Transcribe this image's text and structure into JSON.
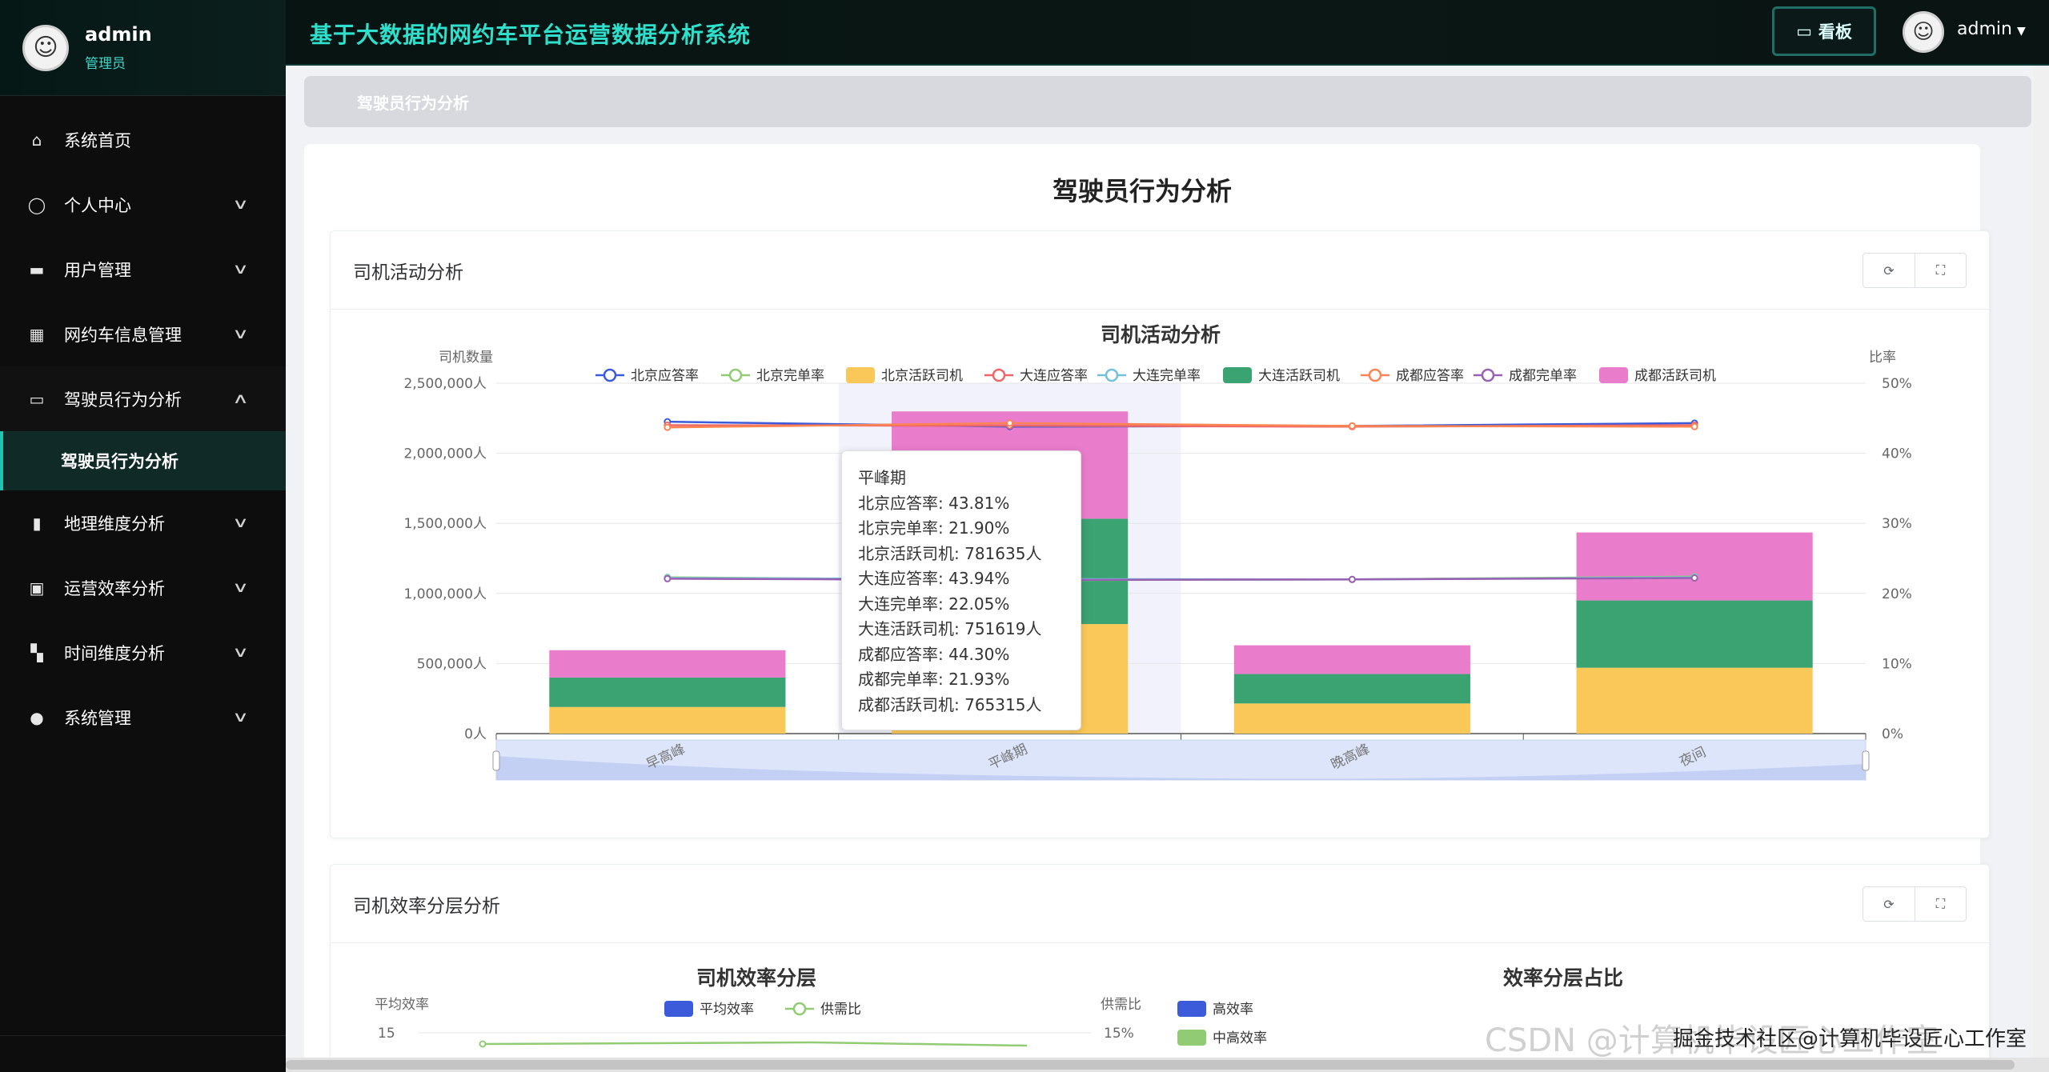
{
  "sidebar": {
    "user_name": "admin",
    "user_role": "管理员",
    "items": [
      {
        "label": "系统首页",
        "icon": "home-icon",
        "glyph": "⌂",
        "arrow": ""
      },
      {
        "label": "个人中心",
        "icon": "user-icon",
        "glyph": "◯",
        "arrow": "∨"
      },
      {
        "label": "用户管理",
        "icon": "briefcase-icon",
        "glyph": "▬",
        "arrow": "∨"
      },
      {
        "label": "网约车信息管理",
        "icon": "calendar-icon",
        "glyph": "▦",
        "arrow": "∨"
      },
      {
        "label": "驾驶员行为分析",
        "icon": "chat-icon",
        "glyph": "▭",
        "arrow": "∧"
      },
      {
        "label": "地理维度分析",
        "icon": "chart-icon",
        "glyph": "▮",
        "arrow": "∨"
      },
      {
        "label": "运营效率分析",
        "icon": "clipboard-icon",
        "glyph": "▣",
        "arrow": "∨"
      },
      {
        "label": "时间维度分析",
        "icon": "grid-icon",
        "glyph": "▚",
        "arrow": "∨"
      },
      {
        "label": "系统管理",
        "icon": "person-icon",
        "glyph": "●",
        "arrow": "∨"
      }
    ],
    "sub_item": "驾驶员行为分析"
  },
  "topbar": {
    "title": "基于大数据的网约车平台运营数据分析系统",
    "kanban_label": "看板",
    "user_name": "admin"
  },
  "breadcrumb": "驾驶员行为分析",
  "page_title": "驾驶员行为分析",
  "cards": {
    "activity_title": "司机活动分析",
    "efficiency_title": "司机效率分层分析"
  },
  "colors": {
    "beijing_rate": "#3b5bdb",
    "beijing_done": "#91cc75",
    "beijing_active": "#fac858",
    "dalian_rate": "#ee6666",
    "dalian_done": "#73c0de",
    "dalian_active": "#3ba272",
    "chengdu_rate": "#fc8452",
    "chengdu_done": "#9a60b4",
    "chengdu_active": "#ea7ccc"
  },
  "chart_data": [
    {
      "type": "bar",
      "title": "司机活动分析",
      "ylabel": "司机数量",
      "y2label": "比率",
      "categories": [
        "早高峰",
        "平峰期",
        "晚高峰",
        "夜间"
      ],
      "ylim": [
        0,
        2500000
      ],
      "y2lim": [
        0,
        50
      ],
      "y_ticks": [
        "0人",
        "500,000人",
        "1,000,000人",
        "1,500,000人",
        "2,000,000人",
        "2,500,000人"
      ],
      "y2_ticks": [
        "0%",
        "10%",
        "20%",
        "30%",
        "40%",
        "50%"
      ],
      "stacked_series": [
        {
          "name": "北京活跃司机",
          "values": [
            190000,
            781635,
            215000,
            470000
          ]
        },
        {
          "name": "大连活跃司机",
          "values": [
            210000,
            751619,
            210000,
            480000
          ]
        },
        {
          "name": "成都活跃司机",
          "values": [
            195000,
            765315,
            205000,
            485000
          ]
        }
      ],
      "line_series": [
        {
          "name": "北京应答率",
          "values": [
            44.5,
            43.81,
            43.9,
            44.3
          ]
        },
        {
          "name": "北京完单率",
          "values": [
            22.3,
            21.9,
            22.0,
            22.4
          ]
        },
        {
          "name": "大连应答率",
          "values": [
            44.0,
            43.94,
            43.8,
            44.0
          ]
        },
        {
          "name": "大连完单率",
          "values": [
            22.2,
            22.05,
            22.0,
            22.3
          ]
        },
        {
          "name": "成都应答率",
          "values": [
            43.7,
            44.3,
            43.9,
            43.8
          ]
        },
        {
          "name": "成都完单率",
          "values": [
            22.1,
            21.93,
            22.0,
            22.2
          ]
        }
      ],
      "legend": [
        "北京应答率",
        "北京完单率",
        "北京活跃司机",
        "大连应答率",
        "大连完单率",
        "大连活跃司机",
        "成都应答率",
        "成都完单率",
        "成都活跃司机"
      ],
      "tooltip": {
        "title": "平峰期",
        "lines": [
          "北京应答率: 43.81%",
          "北京完单率: 21.90%",
          "北京活跃司机: 781635人",
          "大连应答率: 43.94%",
          "大连完单率: 22.05%",
          "大连活跃司机: 751619人",
          "成都应答率: 44.30%",
          "成都完单率: 21.93%",
          "成都活跃司机: 765315人"
        ]
      }
    },
    {
      "type": "line",
      "title": "司机效率分层",
      "ylabel": "平均效率",
      "y2label": "供需比",
      "legend": [
        "平均效率",
        "供需比"
      ],
      "y_top_tick": "15",
      "y2_top_tick": "15%"
    },
    {
      "type": "pie",
      "title": "效率分层占比",
      "legend": [
        "高效率",
        "中高效率"
      ]
    }
  ],
  "watermark": "CSDN @计算机毕设匠心工作室",
  "watermark2": "掘金技术社区@计算机毕设匠心工作室"
}
